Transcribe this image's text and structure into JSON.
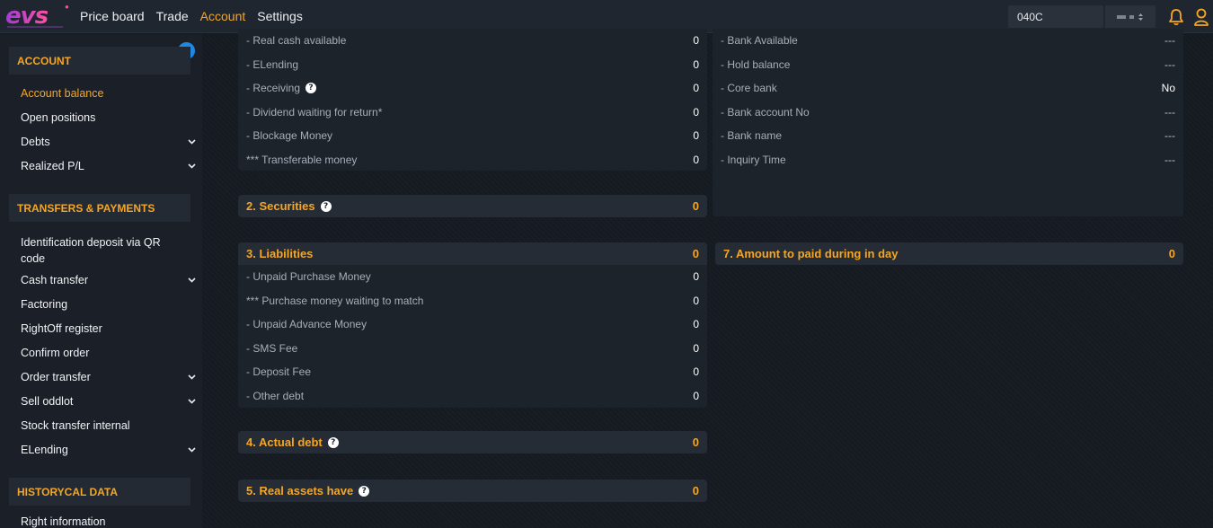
{
  "header": {
    "logo_text": "evs",
    "nav": [
      "Price board",
      "Trade",
      "Account",
      "Settings"
    ],
    "active_nav": "Account",
    "account_code": "040C",
    "sub_account": "•• ▪ •"
  },
  "sidebar": {
    "sections": [
      {
        "title": "ACCOUNT",
        "items": [
          {
            "label": "Account balance",
            "active": true,
            "expandable": false
          },
          {
            "label": "Open positions",
            "expandable": false
          },
          {
            "label": "Debts",
            "expandable": true
          },
          {
            "label": "Realized P/L",
            "expandable": true
          }
        ]
      },
      {
        "title": "TRANSFERS & PAYMENTS",
        "items": [
          {
            "label": "Identification deposit via QR code",
            "expandable": false
          },
          {
            "label": "Cash transfer",
            "expandable": true
          },
          {
            "label": "Factoring",
            "expandable": false
          },
          {
            "label": "RightOff register",
            "expandable": false
          },
          {
            "label": "Confirm order",
            "expandable": false
          },
          {
            "label": "Order transfer",
            "expandable": true
          },
          {
            "label": "Sell oddlot",
            "expandable": true
          },
          {
            "label": "Stock transfer internal",
            "expandable": false
          },
          {
            "label": "ELending",
            "expandable": true
          }
        ]
      },
      {
        "title": "HISTORYCAL DATA",
        "items": [
          {
            "label": "Right information",
            "expandable": false
          }
        ]
      }
    ]
  },
  "cash_rows": [
    {
      "label": "- Real cash available",
      "value": "0"
    },
    {
      "label": "- ELending",
      "value": "0"
    },
    {
      "label": "- Receiving",
      "value": "0",
      "help": true
    },
    {
      "label": "- Dividend waiting for return*",
      "value": "0"
    },
    {
      "label": "- Blockage Money",
      "value": "0"
    },
    {
      "label": "*** Transferable money",
      "value": "0"
    }
  ],
  "bank_rows": [
    {
      "label": "- Bank Available",
      "value": "---"
    },
    {
      "label": "- Hold balance",
      "value": "---"
    },
    {
      "label": "- Core bank",
      "value": "No"
    },
    {
      "label": "- Bank account No",
      "value": "---"
    },
    {
      "label": "- Bank name",
      "value": "---"
    },
    {
      "label": "- Inquiry Time",
      "value": "---"
    }
  ],
  "securities": {
    "title": "2. Securities",
    "value": "0"
  },
  "liabilities": {
    "title": "3. Liabilities",
    "value": "0",
    "rows": [
      {
        "label": "- Unpaid Purchase Money",
        "value": "0"
      },
      {
        "label": "*** Purchase money waiting to match",
        "value": "0"
      },
      {
        "label": "- Unpaid Advance Money",
        "value": "0"
      },
      {
        "label": "- SMS Fee",
        "value": "0"
      },
      {
        "label": "- Deposit Fee",
        "value": "0"
      },
      {
        "label": "- Other debt",
        "value": "0"
      }
    ]
  },
  "actual_debt": {
    "title": "4. Actual debt",
    "value": "0"
  },
  "real_assets": {
    "title": "5. Real assets have",
    "value": "0"
  },
  "amount_paid": {
    "title": "7. Amount to paid during in day",
    "value": "0"
  },
  "help_glyph": "?"
}
